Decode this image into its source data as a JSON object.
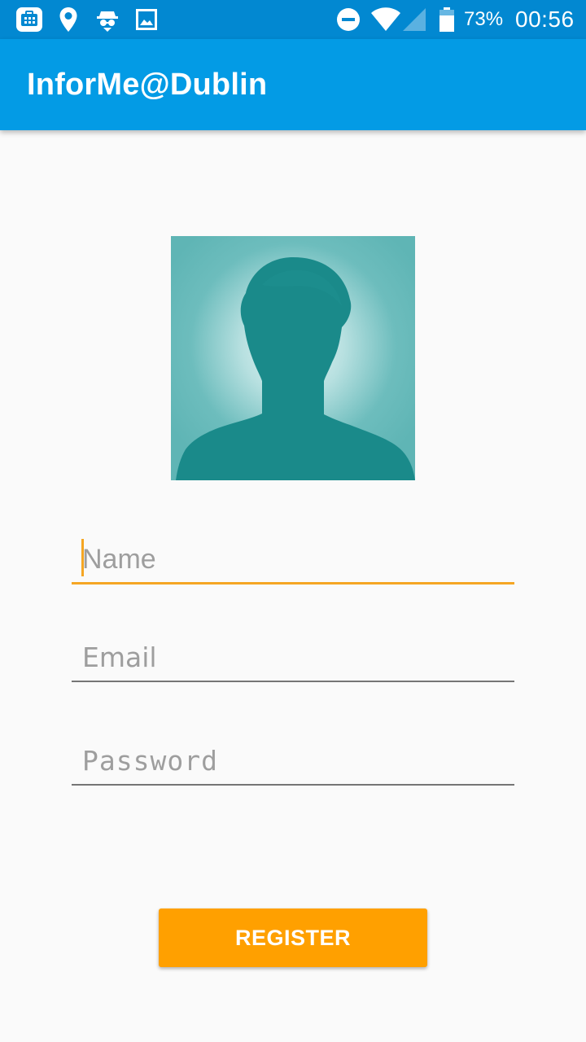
{
  "status_bar": {
    "icons": [
      "app-notification-icon",
      "location-pin-icon",
      "incognito-icon",
      "image-icon",
      "do-not-disturb-icon",
      "wifi-icon",
      "cellular-signal-icon",
      "battery-icon"
    ],
    "battery_percent": "73%",
    "time": "00:56",
    "background_color": "#0288d1"
  },
  "app_bar": {
    "title": "InforMe@Dublin",
    "background_color": "#039be5"
  },
  "avatar": {
    "icon": "profile-silhouette-icon",
    "background_color": "#6dbdbd",
    "silhouette_color": "#1a8a8a"
  },
  "form": {
    "name": {
      "placeholder": "Name",
      "value": "",
      "focused": true
    },
    "email": {
      "placeholder": "Email",
      "value": ""
    },
    "password": {
      "placeholder": "Password",
      "value": ""
    }
  },
  "register_button": {
    "label": "REGISTER",
    "color": "#ffa000"
  },
  "accent_color": "#f5a623"
}
